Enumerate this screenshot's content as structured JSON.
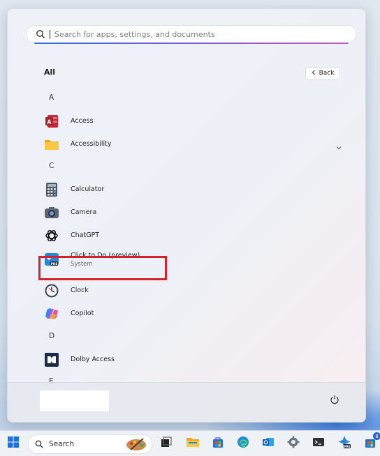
{
  "search": {
    "placeholder": "Search for apps, settings, and documents"
  },
  "header": {
    "title": "All",
    "back_label": "Back"
  },
  "letters": [
    "A",
    "C",
    "D",
    "E"
  ],
  "apps": {
    "access": {
      "name": "Access",
      "icon": "access-icon"
    },
    "accessibility": {
      "name": "Accessibility",
      "icon": "folder-icon"
    },
    "calculator": {
      "name": "Calculator",
      "icon": "calculator-icon"
    },
    "camera": {
      "name": "Camera",
      "icon": "camera-icon"
    },
    "chatgpt": {
      "name": "ChatGPT",
      "icon": "chatgpt-icon"
    },
    "click_to_do": {
      "name": "Click to Do (preview)",
      "subtitle": "System",
      "icon": "click-to-do-icon"
    },
    "clock": {
      "name": "Clock",
      "icon": "clock-icon"
    },
    "copilot": {
      "name": "Copilot",
      "icon": "copilot-icon"
    },
    "dolby": {
      "name": "Dolby Access",
      "icon": "dolby-icon"
    }
  },
  "taskbar": {
    "search_label": "Search",
    "store_badge": "8"
  },
  "colors": {
    "highlight": "#d0232b",
    "accent": "#2b62c9"
  }
}
